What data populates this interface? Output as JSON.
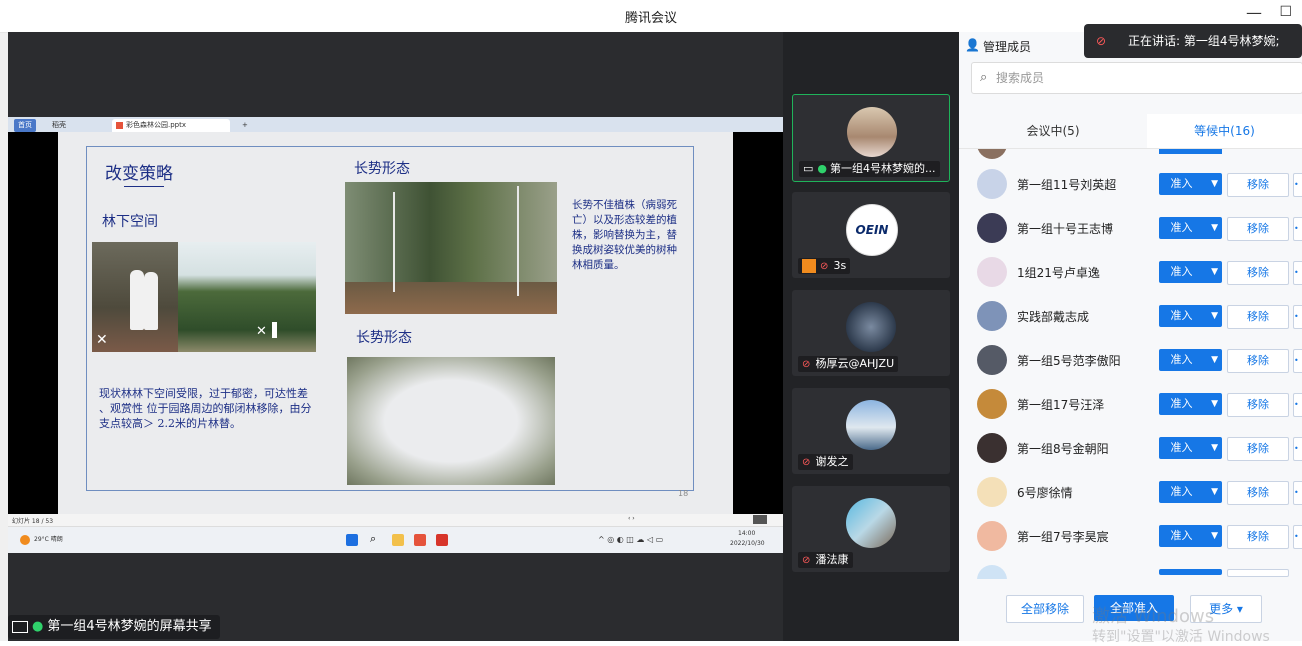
{
  "window": {
    "title": "腾讯会议"
  },
  "browser": {
    "tabs": [
      "首页",
      "稻壳",
      "彩色森林公园.pptx"
    ]
  },
  "slide": {
    "left_title": "改变策略",
    "left_subtitle": "林下空间",
    "left_body": "现状林林下空间受限，过于郁密，可达性差 、观赏性      位于园路周边的郁闭林移除，由分支点较高＞ 2.2米的片林替。",
    "right_title_1": "长势形态",
    "right_title_2": "长势形态",
    "right_body": "长势不佳植株（病弱死亡）以及形态较差的植株，影响替换为主，替换成树姿较优美的树种林相质量。",
    "page_num": "18",
    "status_left": "幻灯片 18 / 53"
  },
  "taskbar": {
    "weather": "29°C 晴朗",
    "time": "14:00",
    "date": "2022/10/30"
  },
  "share_label": "第一组4号林梦婉的屏幕共享",
  "speaking": "正在讲话: 第一组4号林梦婉;",
  "tiles": [
    {
      "name": "第一组4号林梦婉的..."
    },
    {
      "name": "3s"
    },
    {
      "name": "杨厚云@AHJZU"
    },
    {
      "name": "谢发之"
    },
    {
      "name": "潘法康"
    }
  ],
  "panel": {
    "header": "管理成员",
    "search_placeholder": "搜索成员",
    "tab_in_meeting": "会议中(5)",
    "tab_waiting": "等候中(16)",
    "admit_label": "准入",
    "remove_label": "移除",
    "members": [
      {
        "name": "第一组11号刘英超",
        "color": "#c8d3e8"
      },
      {
        "name": "第一组十号王志博",
        "color": "#3b3b55"
      },
      {
        "name": "1组21号卢卓逸",
        "color": "#e8d9e6"
      },
      {
        "name": "实践部戴志成",
        "color": "#7e93b8"
      },
      {
        "name": "第一组5号范李傲阳",
        "color": "#555a66"
      },
      {
        "name": "第一组17号汪泽",
        "color": "#c58a3a"
      },
      {
        "name": "第一组8号金朝阳",
        "color": "#3a3030"
      },
      {
        "name": "6号廖徐情",
        "color": "#f4e0b8"
      },
      {
        "name": "第一组7号李昊宸",
        "color": "#f0b9a0"
      }
    ],
    "remove_all": "全部移除",
    "admit_all": "全部准入",
    "more": "更多"
  },
  "watermark": {
    "line1": "激活 Windows",
    "line2": "转到\"设置\"以激活 Windows"
  }
}
